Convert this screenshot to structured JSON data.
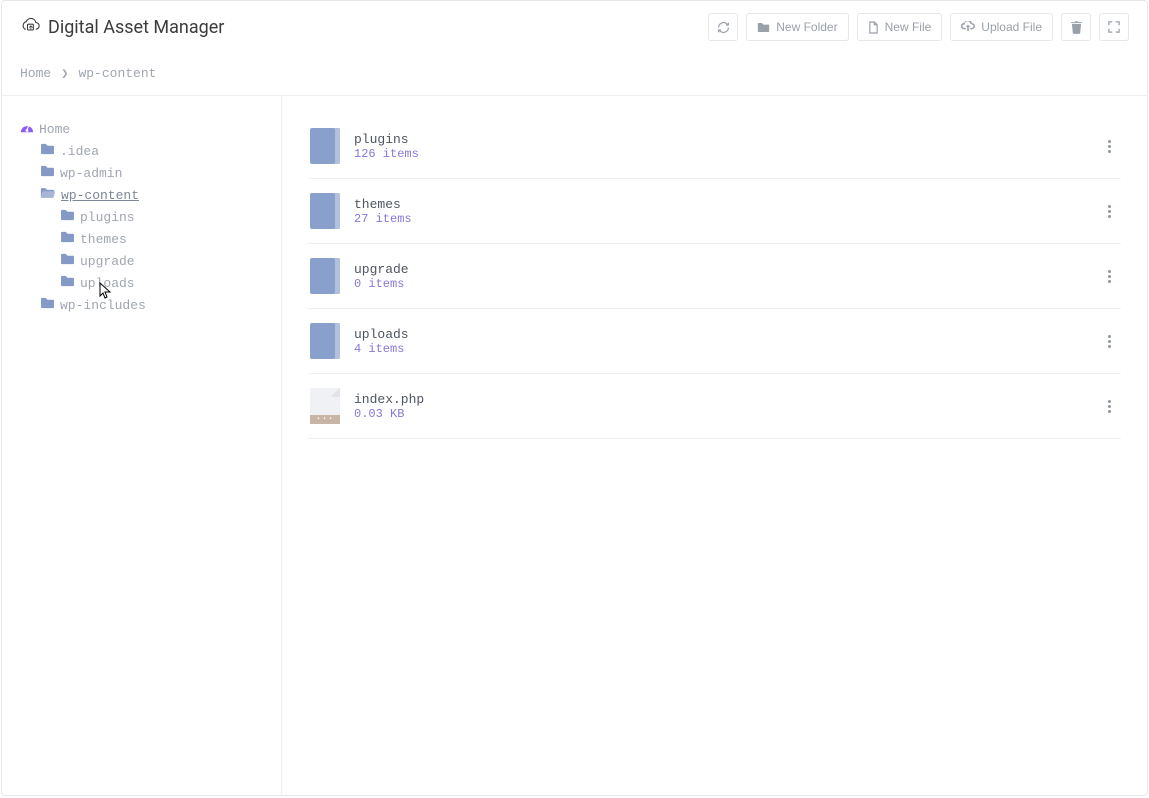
{
  "header": {
    "title": "Digital Asset Manager",
    "buttons": {
      "new_folder": "New Folder",
      "new_file": "New File",
      "upload_file": "Upload File"
    }
  },
  "breadcrumb": {
    "items": [
      "Home",
      "wp-content"
    ]
  },
  "sidebar": {
    "root_label": "Home",
    "items": [
      {
        "label": ".idea"
      },
      {
        "label": "wp-admin"
      },
      {
        "label": "wp-content",
        "current": true,
        "children": [
          {
            "label": "plugins"
          },
          {
            "label": "themes"
          },
          {
            "label": "upgrade"
          },
          {
            "label": "uploads"
          }
        ]
      },
      {
        "label": "wp-includes"
      }
    ]
  },
  "listing": [
    {
      "type": "folder",
      "name": "plugins",
      "meta": "126 items"
    },
    {
      "type": "folder",
      "name": "themes",
      "meta": "27 items"
    },
    {
      "type": "folder",
      "name": "upgrade",
      "meta": "0 items"
    },
    {
      "type": "folder",
      "name": "uploads",
      "meta": "4 items"
    },
    {
      "type": "file",
      "name": "index.php",
      "meta": "0.03 KB"
    }
  ]
}
